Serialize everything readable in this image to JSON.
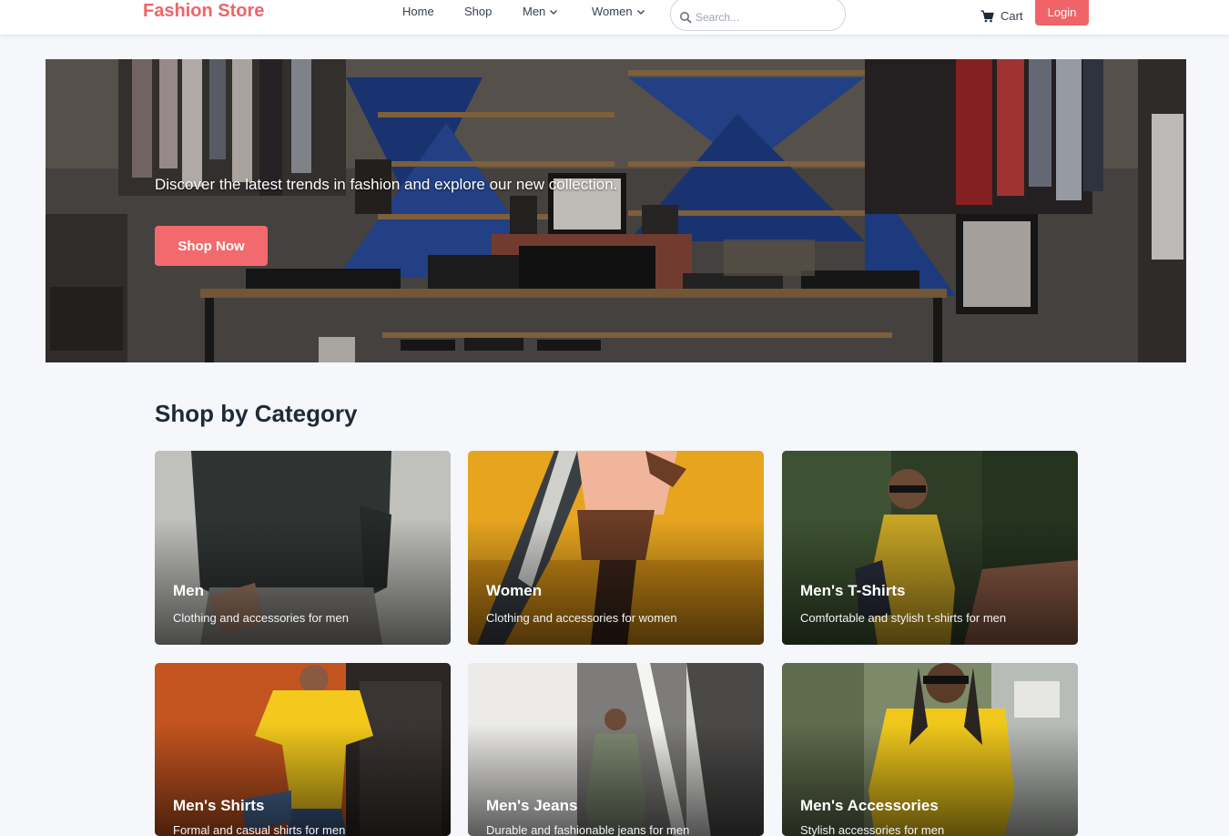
{
  "header": {
    "brand": "Fashion Store",
    "nav": [
      {
        "label": "Home"
      },
      {
        "label": "Shop"
      },
      {
        "label": "Men"
      },
      {
        "label": "Women"
      }
    ],
    "search_placeholder": "Search...",
    "cart_label": "Cart",
    "login_label": "Login"
  },
  "hero": {
    "tagline": "Discover the latest trends in fashion and explore our new collection.",
    "cta_label": "Shop Now"
  },
  "categories": {
    "title": "Shop by Category",
    "items": [
      {
        "title": "Men",
        "description": "Clothing and accessories for men"
      },
      {
        "title": "Women",
        "description": "Clothing and accessories for women"
      },
      {
        "title": "Men's T-Shirts",
        "description": "Comfortable and stylish t-shirts for men"
      },
      {
        "title": "Men's Shirts",
        "description": "Formal and casual shirts for men"
      },
      {
        "title": "Men's Jeans",
        "description": "Durable and fashionable jeans for men"
      },
      {
        "title": "Men's Accessories",
        "description": "Stylish accessories for men"
      }
    ]
  },
  "colors": {
    "brand": "#f06468",
    "background": "#f5f7fb",
    "heading": "#1f2a37"
  }
}
